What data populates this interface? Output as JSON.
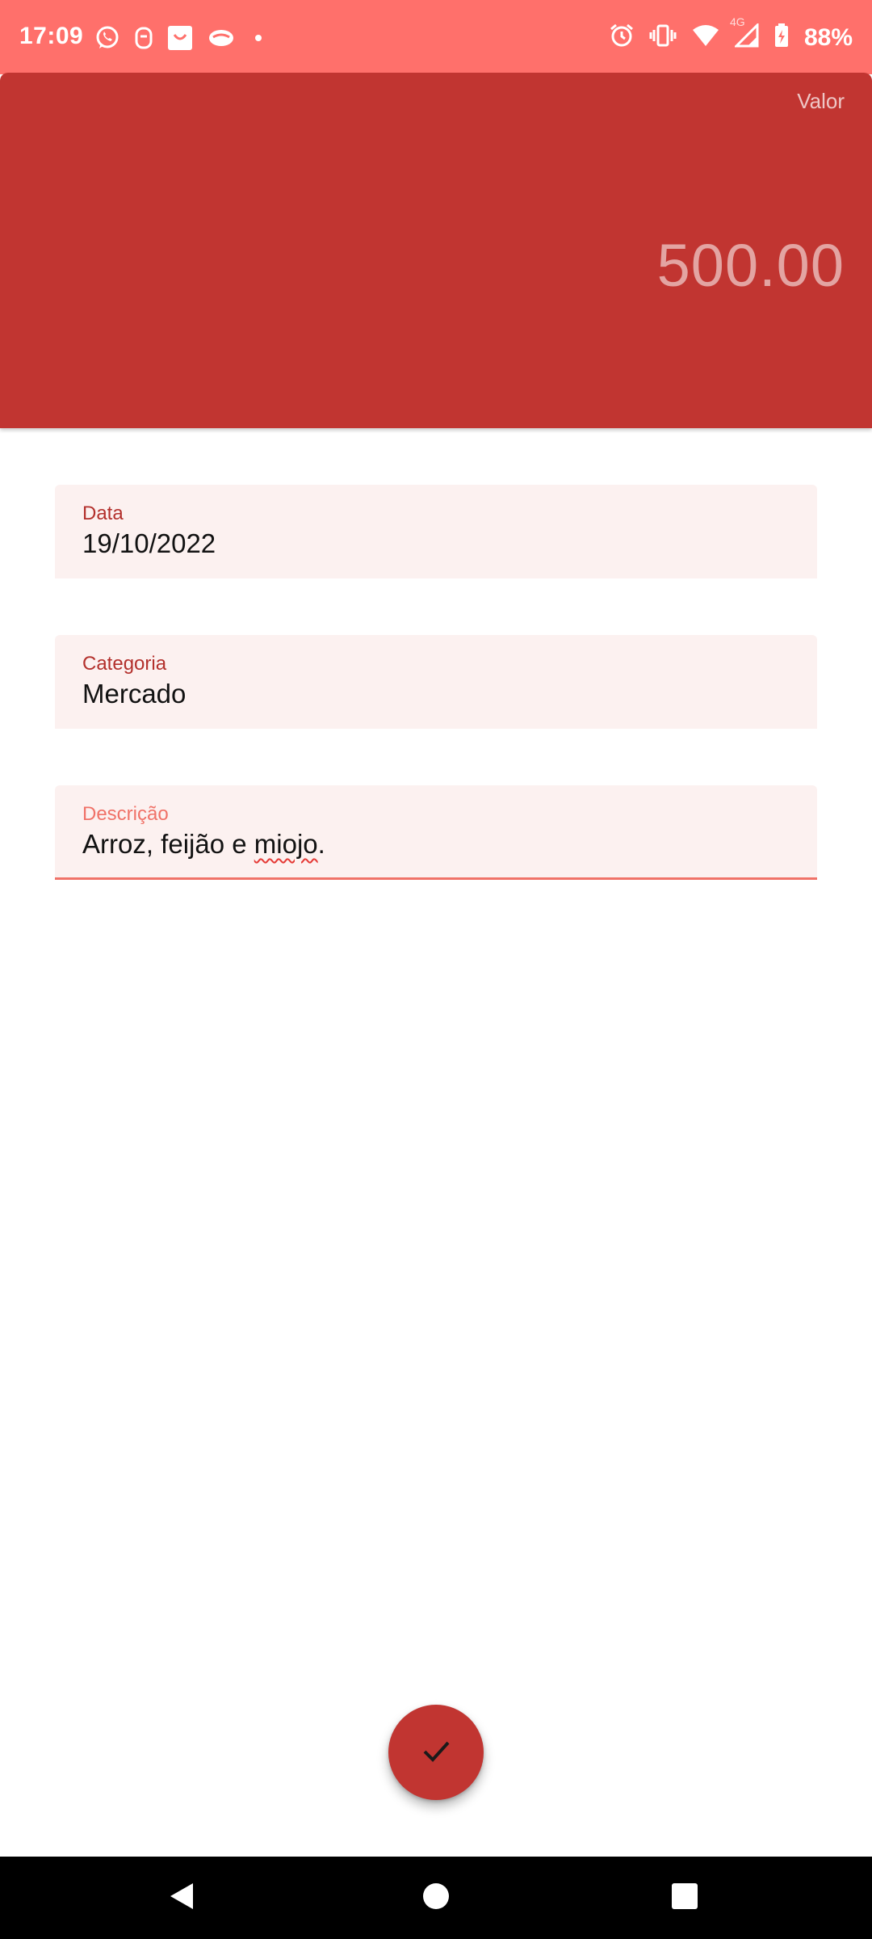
{
  "status_bar": {
    "time": "17:09",
    "left_icons": [
      "whatsapp-icon",
      "app-notification-icon",
      "shopping-bag-icon",
      "controller-icon",
      "dot-icon"
    ],
    "right_icons": [
      "alarm-icon",
      "vibrate-icon",
      "wifi-icon",
      "signal-icon",
      "battery-charging-icon"
    ],
    "network_type": "4G",
    "battery": "88%"
  },
  "header": {
    "valor_label": "Valor",
    "valor_amount": "500.00"
  },
  "form": {
    "date": {
      "label": "Data",
      "value": "19/10/2022"
    },
    "category": {
      "label": "Categoria",
      "value": "Mercado"
    },
    "description": {
      "label": "Descrição",
      "value_part1": "Arroz, feijão e ",
      "value_misspelled": "miojo",
      "value_part2": "."
    }
  },
  "fab": {
    "icon": "check-icon"
  },
  "nav": {
    "back_icon": "back-triangle-icon",
    "home_icon": "home-circle-icon",
    "recents_icon": "recents-square-icon"
  },
  "colors": {
    "status_bar": "#ff706b",
    "header": "#c13531",
    "field_bg": "#fcf1f0",
    "accent_active": "#f07268",
    "label": "#b3302c"
  }
}
